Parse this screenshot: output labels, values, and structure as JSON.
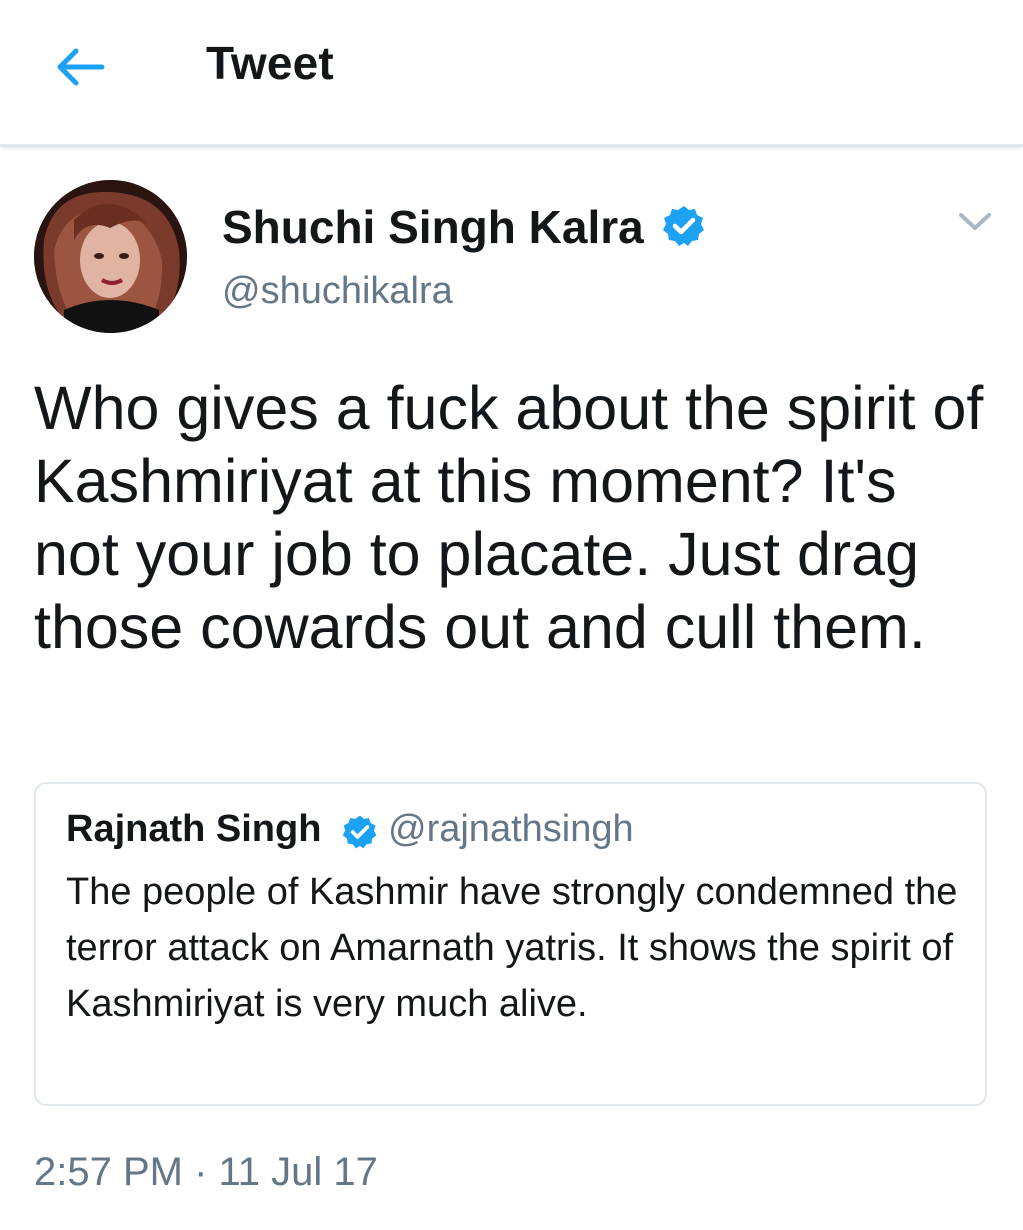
{
  "header": {
    "title": "Tweet",
    "back_icon": "arrow-left-icon",
    "accent": "#1da1f2"
  },
  "tweet": {
    "author": {
      "name": "Shuchi Singh Kalra",
      "handle": "@shuchikalra",
      "verified_icon": "verified-badge-icon"
    },
    "text": "Who gives a fuck about the spirit of Kashmiriyat at this moment? It's not your job to placate. Just drag those cowards out and cull them.",
    "timestamp": "2:57 PM · 11 Jul 17",
    "menu_icon": "chevron-down-icon"
  },
  "quoted": {
    "author": {
      "name": "Rajnath Singh",
      "handle": "@rajnathsingh",
      "verified_icon": "verified-badge-icon"
    },
    "text": "The people of Kashmir have strongly condemned the terror attack on Amarnath yatris. It shows the spirit of Kashmiriyat is very much alive."
  },
  "colors": {
    "text": "#14171a",
    "secondary": "#657786",
    "verified": "#1da1f2",
    "border": "#e1e8ed"
  }
}
